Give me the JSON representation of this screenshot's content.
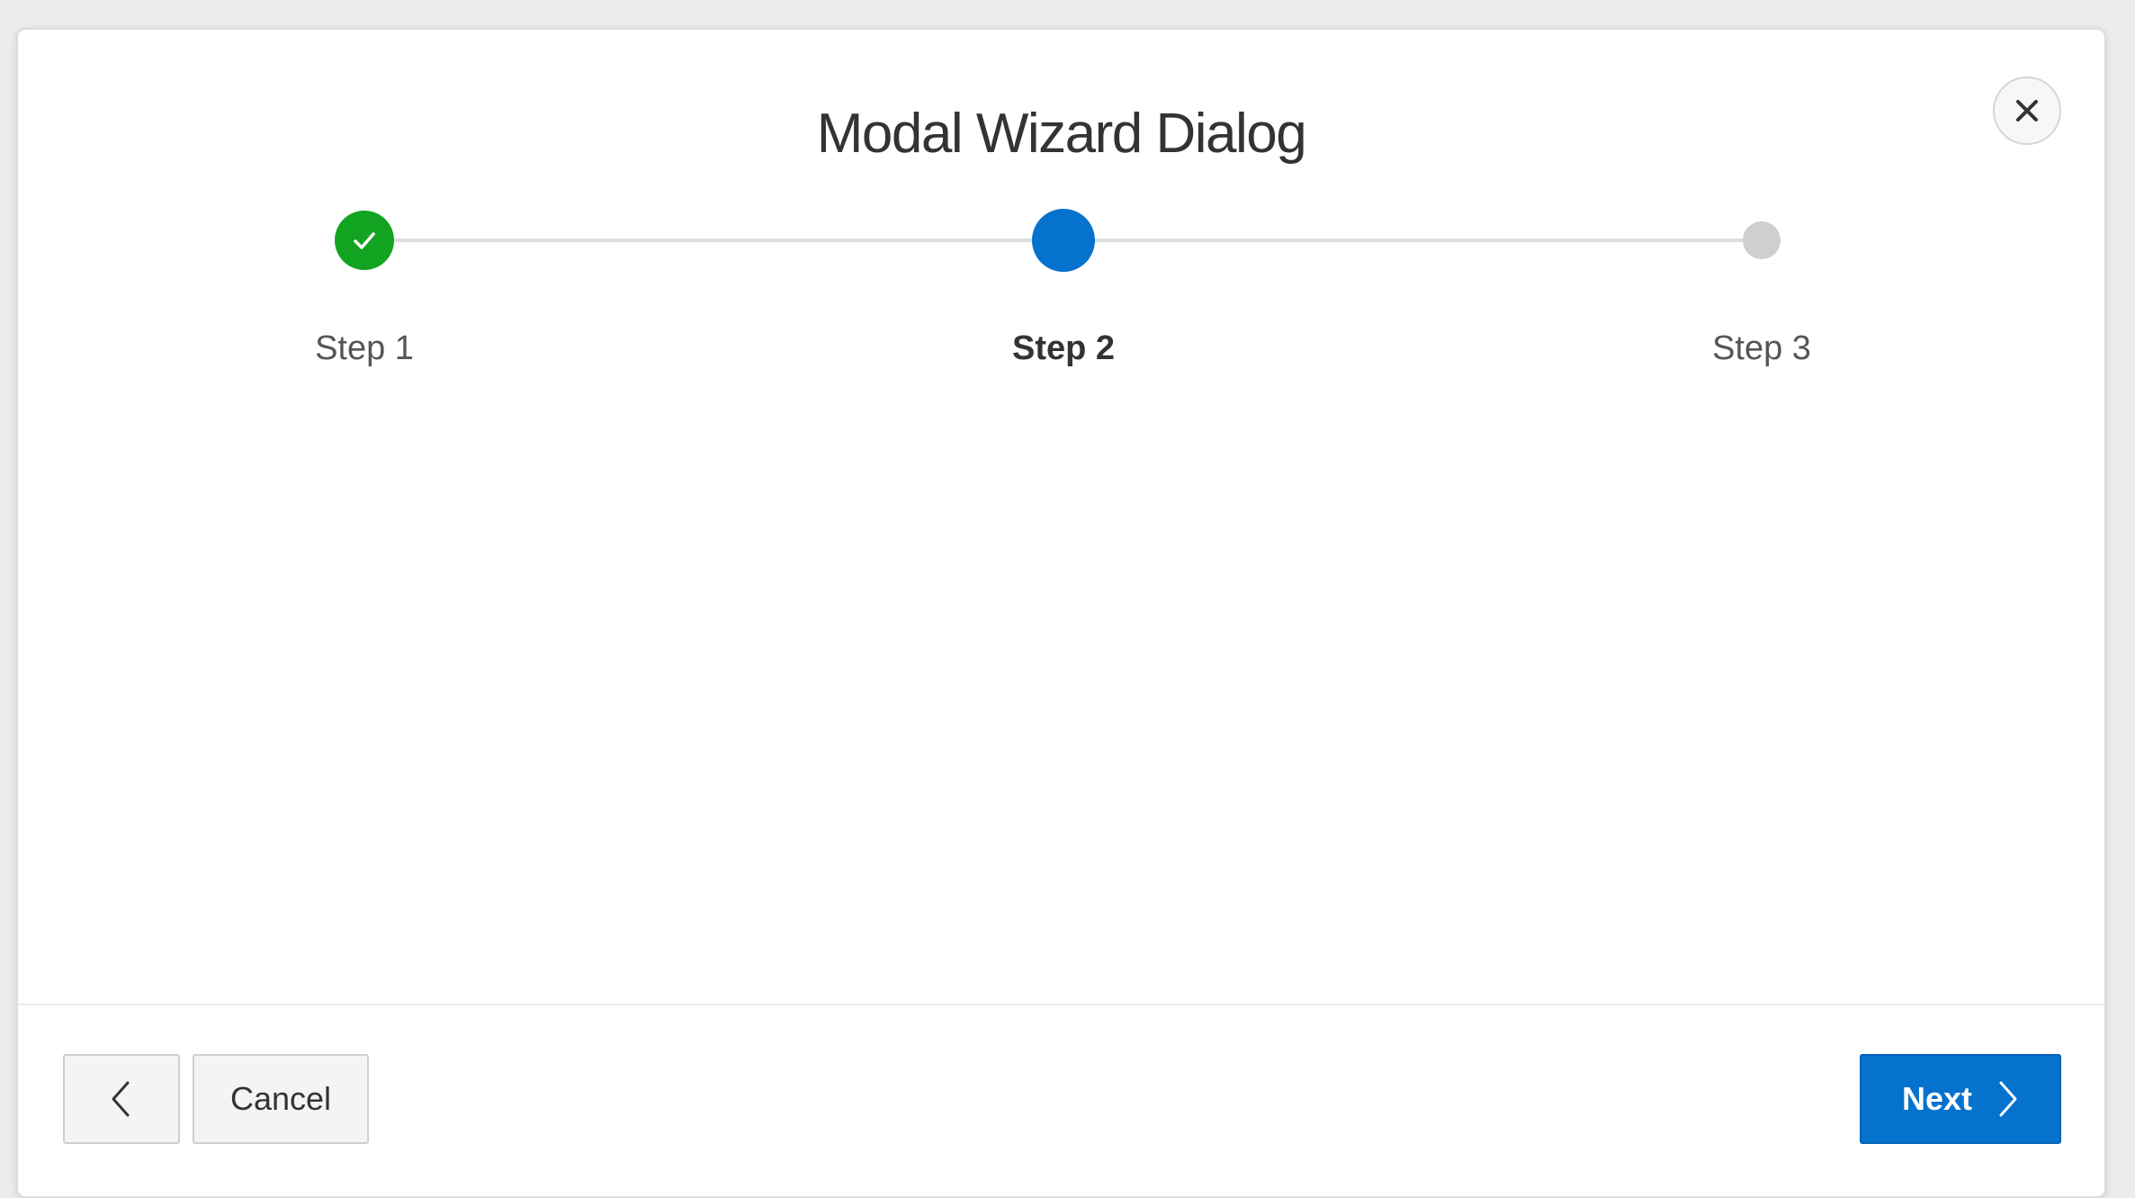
{
  "dialog": {
    "title": "Modal Wizard Dialog",
    "close_icon": "close-icon"
  },
  "train": {
    "steps": [
      {
        "label": "Step 1",
        "state": "completed",
        "icon": "checkmark-icon"
      },
      {
        "label": "Step 2",
        "state": "current"
      },
      {
        "label": "Step 3",
        "state": "not-visited"
      }
    ]
  },
  "footer": {
    "back_icon": "chevron-left-icon",
    "cancel_label": "Cancel",
    "next_label": "Next",
    "next_icon": "chevron-right-icon"
  },
  "colors": {
    "completed": "#12a321",
    "current": "#0572ce",
    "not_visited": "#cfcfcf",
    "primary_button": "#0572ce"
  }
}
